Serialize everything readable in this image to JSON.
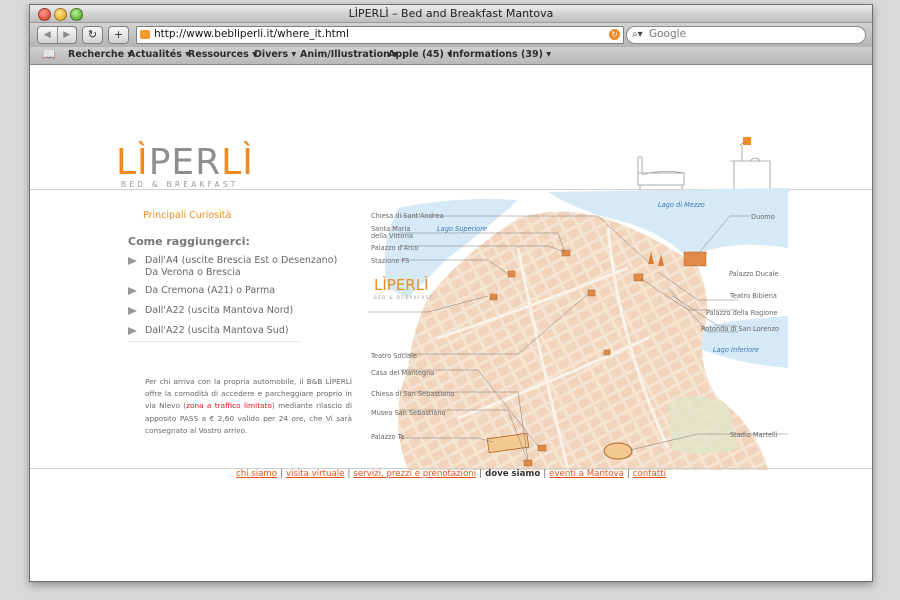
{
  "window": {
    "title": "LÌPERLÌ – Bed and Breakfast Mantova"
  },
  "toolbar": {
    "back_glyph": "◀",
    "forward_glyph": "▶",
    "reload_glyph": "↻",
    "add_glyph": "+",
    "url": "http://www.bebliperli.it/where_it.html",
    "search_placeholder": "Google"
  },
  "bookmarks": [
    "Recherche ▾",
    "Actualités ▾",
    "Ressources ▾",
    "Divers ▾",
    "Anim/Illustration ▾",
    "Apple (45) ▾",
    "Informations (39) ▾"
  ],
  "logo": {
    "text_1": "LÌ",
    "text_2": "PER",
    "text_3": "LÌ",
    "subtitle": "BED & BREAKFAST"
  },
  "left": {
    "curiosities_link": "Principali Curiosità",
    "howto_title": "Come raggiungerci:",
    "routes": [
      {
        "line1": "Dall'A4 (uscite Brescia Est o Desenzano)",
        "line2": "Da Verona o Brescia"
      },
      {
        "line1": "Da Cremona (A21) o Parma",
        "line2": ""
      },
      {
        "line1": "Dall'A22 (uscita Mantova Nord)",
        "line2": ""
      },
      {
        "line1": "Dall'A22 (uscita Mantova Sud)",
        "line2": ""
      }
    ],
    "para_before": "Per chi arriva con la propria automobile, il B&B LÌPERLÌ offre la comodità di accedere e parcheggiare proprio in via Nievo (",
    "para_highlight": "zona a traffico limitato",
    "para_after": ") mediante rilascio di apposito PASS a € 2,60 valido per 24 ore, che Vi sarà consegnato al Vostro arrivo."
  },
  "map": {
    "water_labels": [
      "Lago di Mezzo",
      "Lago Superiore",
      "Lago Inferiore"
    ],
    "labels_left": [
      "Chiesa di Sant'Andrea",
      "Santa Maria",
      "della Vittoria",
      "Palazzo d'Arco",
      "Stazione FS",
      "Teatro Sociale",
      "Casa del Mantegna",
      "Chiesa di San Sebastiano",
      "Museo San Sebastiano",
      "Palazzo Te"
    ],
    "labels_right": [
      "Duomo",
      "Palazzo Ducale",
      "Teatro Bibiena",
      "Palazzo della Ragione",
      "Rotonda di San Lorenzo",
      "Stadio Martelli"
    ],
    "map_logo": "LÌPERLÌ",
    "map_logo_sub": "BED & BREAKFAST"
  },
  "footer": {
    "links": [
      "chi siamo",
      "visita virtuale",
      "servizi, prezzi e prenotazioni",
      "dove siamo",
      "eventi a Mantova",
      "contatti"
    ],
    "separator": "|"
  },
  "colors": {
    "brand_orange": "#F08A1B",
    "link_red": "#E5531F",
    "water": "#D6E9F6"
  }
}
